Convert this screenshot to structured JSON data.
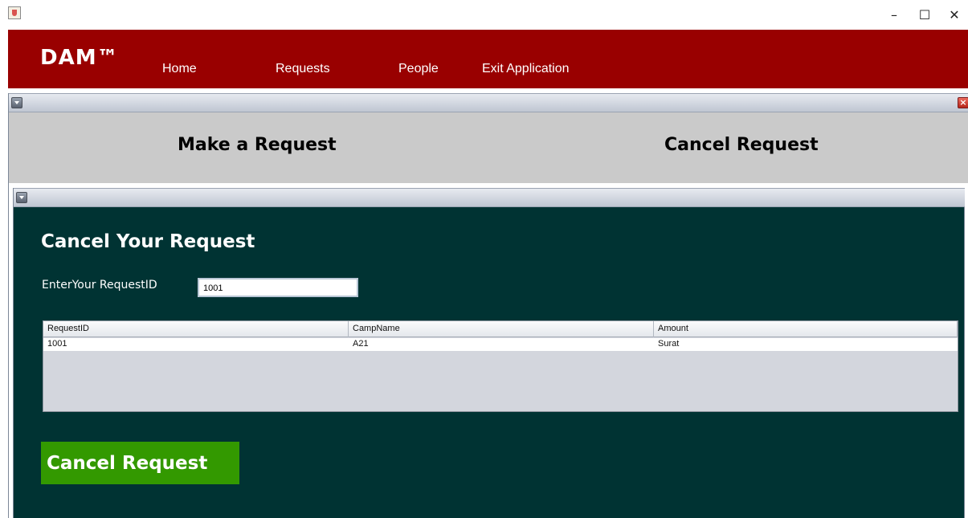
{
  "window": {
    "controls": {
      "minimize": "–",
      "maximize": "☐",
      "close": "✕"
    }
  },
  "menubar": {
    "logo": "DAM™",
    "items": [
      {
        "label": "Home"
      },
      {
        "label": "Requests"
      },
      {
        "label": "People"
      },
      {
        "label": "Exit Application"
      }
    ]
  },
  "request_frame": {
    "tabs": [
      {
        "label": "Make a Request"
      },
      {
        "label": "Cancel Request"
      }
    ]
  },
  "cancel_panel": {
    "heading": "Cancel Your Request",
    "field_label": "EnterYour RequestID",
    "request_id_value": "1001",
    "table": {
      "columns": [
        "RequestID",
        "CampName",
        "Amount"
      ],
      "rows": [
        [
          "1001",
          "A21",
          "Surat"
        ]
      ]
    },
    "cancel_button_label": "Cancel Request"
  },
  "colors": {
    "menubar": "#990000",
    "content_bg": "#003333",
    "tab_panel": "#cacaca",
    "cancel_button": "#339900"
  },
  "icons": [
    "java-app-icon",
    "internal-frame-menu-icon",
    "internal-frame-close-icon"
  ]
}
